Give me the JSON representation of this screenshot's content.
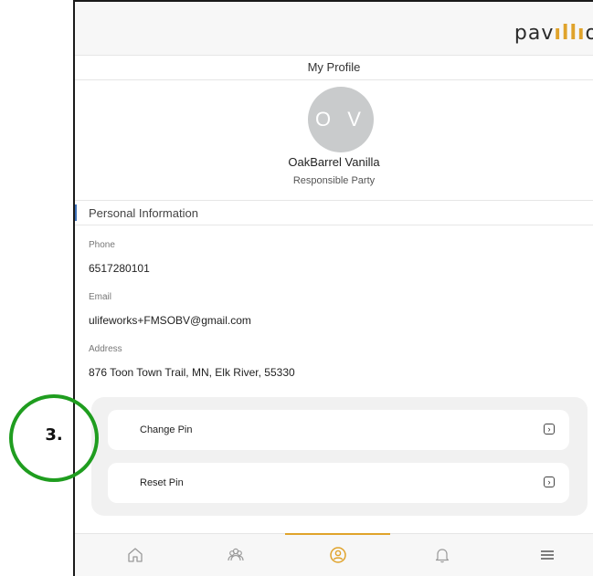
{
  "header": {
    "logo_prefix": "pav",
    "logo_mark": "ıllı",
    "logo_suffix": "o"
  },
  "page": {
    "title": "My Profile"
  },
  "profile": {
    "initials": "O V",
    "name": "OakBarrel Vanilla",
    "role": "Responsible Party"
  },
  "personal_info": {
    "section_title": "Personal Information",
    "phone_label": "Phone",
    "phone": "6517280101",
    "email_label": "Email",
    "email": "ulifeworks+FMSOBV@gmail.com",
    "address_label": "Address",
    "address": "876 Toon Town Trail, MN, Elk River, 55330"
  },
  "pin_actions": {
    "change_pin": "Change Pin",
    "reset_pin": "Reset Pin",
    "chevron": "›"
  },
  "bottom_nav": {
    "items": [
      {
        "icon": "home-icon"
      },
      {
        "icon": "community-icon"
      },
      {
        "icon": "profile-icon",
        "active": true
      },
      {
        "icon": "bell-icon"
      },
      {
        "icon": "menu-icon"
      }
    ]
  },
  "annotation": {
    "step": "3."
  },
  "colors": {
    "accent": "#e0a32b",
    "section_marker": "#3d6fb6",
    "annotation_ring": "#1f9d1f",
    "avatar": "#c9cbcc"
  }
}
